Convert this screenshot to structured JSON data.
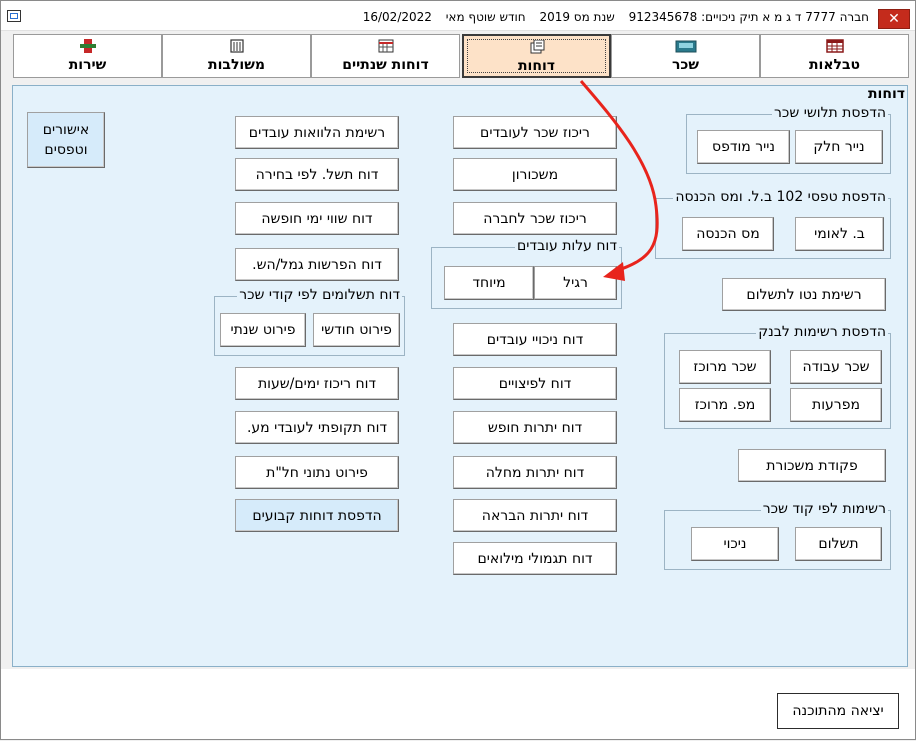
{
  "titlebar": {
    "company": "חברה 7777 ד ג מ א תיק ניכויים: 912345678",
    "tax_year": "שנת מס 2019",
    "month": "חודש שוטף מאי",
    "date": "16/02/2022",
    "close_glyph": "✕"
  },
  "tabs": [
    {
      "label": "שירות",
      "icon": "wrench-icon"
    },
    {
      "label": "משולבות",
      "icon": "building-icon"
    },
    {
      "label": "דוחות שנתיים",
      "icon": "calendar-icon"
    },
    {
      "label": "דוחות",
      "icon": "report-icon"
    },
    {
      "label": "שכר",
      "icon": "cash-register-icon"
    },
    {
      "label": "טבלאות",
      "icon": "table-icon"
    }
  ],
  "panel": {
    "title": "דוחות"
  },
  "approvals_button": "אישורים וטפסים",
  "left_column": [
    "רשימת הלוואות עובדים",
    "דוח תשל. לפי בחירה",
    "דוח שווי ימי חופשה",
    "דוח הפרשות גמל/הש."
  ],
  "payments_by_code": {
    "label": "דוח תשלומים לפי קודי שכר",
    "monthly": "פירוט חודשי",
    "yearly": "פירוט שנתי"
  },
  "left_column_lower": [
    "דוח ריכוז ימים/שעות",
    "דוח תקופתי לעובדי מע.",
    "פירוט נתוני חל\"ת",
    "הדפסת דוחות קבועים"
  ],
  "middle_column": [
    "ריכוז שכר לעובדים",
    "משכורון",
    "ריכוז שכר לחברה"
  ],
  "employee_cost": {
    "label": "דוח עלות עובדים",
    "regular": "רגיל",
    "special": "מיוחד"
  },
  "middle_column_lower": [
    "דוח ניכויי עובדים",
    "דוח לפיצויים",
    "דוח יתרות חופש",
    "דוח יתרות מחלה",
    "דוח יתרות הבראה",
    "דוח תגמולי מילואים"
  ],
  "payslip_print": {
    "label": "הדפסת תלושי שכר",
    "plain": "נייר חלק",
    "printed": "נייר מודפס"
  },
  "form102_print": {
    "label": "הדפסת טפסי 102 ב.ל. ומס הכנסה",
    "ni": "ב. לאומי",
    "tax": "מס הכנסה"
  },
  "net_list": "רשימת נטו לתשלום",
  "bank_lists": {
    "label": "הדפסת רשימות לבנק",
    "work_salary": "שכר עבודה",
    "central_salary": "שכר מרוכז",
    "itemized": "מפרעות",
    "central_ma": "מפ. מרוכז"
  },
  "salary_order": "פקודת משכורת",
  "lists_by_code": {
    "label": "רשימות לפי קוד שכר",
    "payment": "תשלום",
    "deduction": "ניכוי"
  },
  "exit_button": "יציאה מהתוכנה",
  "colors": {
    "panel_bg": "#e4f2fb",
    "active_tab_bg": "#fde2c8",
    "arrow": "#e8241c",
    "close_bg": "#c42b1c"
  }
}
